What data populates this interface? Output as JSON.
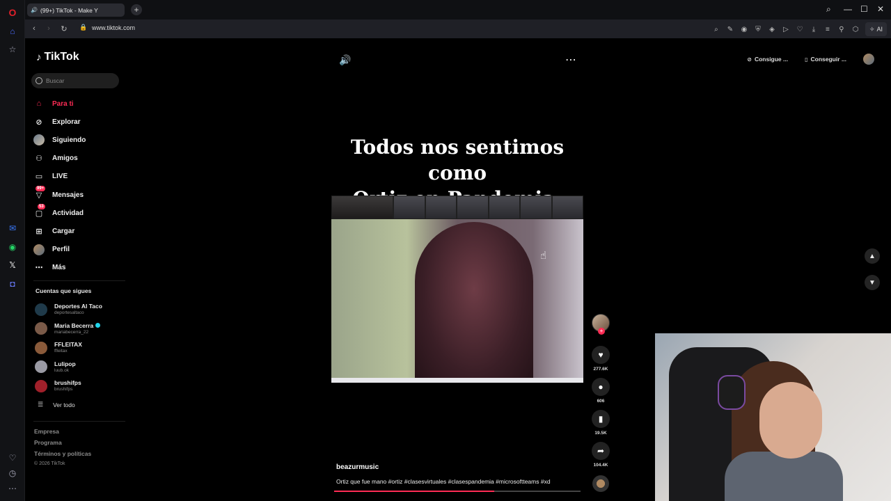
{
  "browser": {
    "tab_title": "(99+) TikTok - Make Y",
    "new_tab": "+",
    "url": "www.tiktok.com",
    "ai_label": "AI"
  },
  "tiktok": {
    "brand": "TikTok",
    "search_placeholder": "Buscar",
    "menu": [
      {
        "label": "Para ti",
        "icon": "home-icon",
        "active": true
      },
      {
        "label": "Explorar",
        "icon": "compass-icon"
      },
      {
        "label": "Siguiendo",
        "icon": "avatar"
      },
      {
        "label": "Amigos",
        "icon": "friends-icon"
      },
      {
        "label": "LIVE",
        "icon": "live-icon"
      },
      {
        "label": "Mensajes",
        "icon": "messages-icon",
        "badge": "99+"
      },
      {
        "label": "Actividad",
        "icon": "activity-icon",
        "badge": "53"
      },
      {
        "label": "Cargar",
        "icon": "upload-icon"
      },
      {
        "label": "Perfil",
        "icon": "avatar"
      },
      {
        "label": "Más",
        "icon": "more-icon"
      }
    ],
    "following_title": "Cuentas que sigues",
    "following": [
      {
        "name": "Deportes Al Taco",
        "user": "deportesaltaco",
        "color": "#1f3a4a"
      },
      {
        "name": "Maria Becerra",
        "user": "mariabecerra_22",
        "verified": true,
        "color": "#7a5a48"
      },
      {
        "name": "FFLEITAX",
        "user": "ffleitax",
        "color": "#8a5a3a"
      },
      {
        "name": "Lulipop",
        "user": "luub.ok",
        "color": "#9a9aa4"
      },
      {
        "name": "brushifps",
        "user": "brushifps",
        "color": "#a0202a"
      }
    ],
    "see_all": "Ver todo",
    "footer": [
      "Empresa",
      "Programa",
      "Términos y políticas"
    ],
    "copyright": "© 2026 TikTok",
    "top_buttons": [
      "Consigue ...",
      "Conseguir ..."
    ]
  },
  "video": {
    "title_line1": "Todos nos sentimos como",
    "title_line2": "Ortiz en Pandemia:",
    "author": "beazurmusic",
    "caption": "Ortiz que fue mano #ortiz #clasesvirtuales #clasespandemia #microsoftteams #xd",
    "likes": "277.6K",
    "comments": "606",
    "saves": "19.5K",
    "shares": "104.4K",
    "progress": 0.65
  }
}
